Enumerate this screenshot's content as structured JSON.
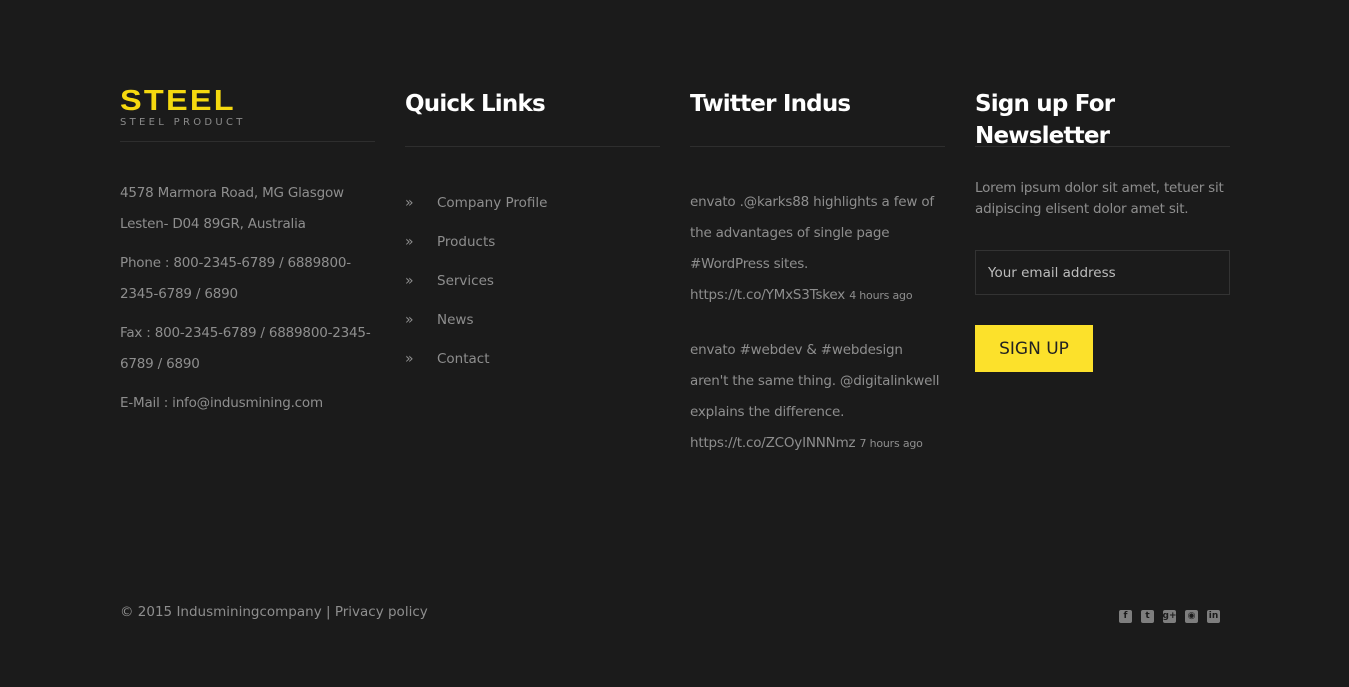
{
  "logo": {
    "main": "STEEL",
    "sub": "STEEL PRODUCT"
  },
  "contact": {
    "address_line1": "4578 Marmora Road, MG Glasgow",
    "address_line2": "Lesten- D04 89GR, Australia",
    "phone": "Phone : 800-2345-6789 / 6889800-2345-6789 / 6890",
    "fax": "Fax : 800-2345-6789 / 6889800-2345-6789 / 6890",
    "email": "E-Mail : info@indusmining.com"
  },
  "quick_links": {
    "title": "Quick Links",
    "arrow": "»",
    "items": [
      "Company Profile",
      "Products",
      "Services",
      "News",
      "Contact"
    ]
  },
  "twitter": {
    "title": "Twitter Indus",
    "tweets": [
      {
        "text": "envato .@karks88 highlights a few of the advantages of single page #WordPress sites.",
        "link": "https://t.co/YMxS3Tskex",
        "time": "4 hours ago"
      },
      {
        "text": "envato #webdev & #webdesign aren't the same thing. @digitalinkwell explains the difference.",
        "link": "https://t.co/ZCOyINNNmz",
        "time": "7 hours ago"
      }
    ]
  },
  "newsletter": {
    "title": "Sign up For Newsletter",
    "text": "Lorem ipsum dolor sit amet, tetuer sit adipiscing elisent dolor amet sit.",
    "placeholder": "Your email address",
    "button": "SIGN UP"
  },
  "bottom": {
    "copyright": "© 2015 Indusminingcompany | Privacy policy",
    "socials": [
      {
        "icon": "facebook-icon",
        "glyph": "f"
      },
      {
        "icon": "twitter-icon",
        "glyph": "t"
      },
      {
        "icon": "google-plus-icon",
        "glyph": "g+"
      },
      {
        "icon": "rss-icon",
        "glyph": "◉"
      },
      {
        "icon": "linkedin-icon",
        "glyph": "in"
      }
    ]
  },
  "colors": {
    "background": "#1b1b1b",
    "accent": "#fce12b",
    "text": "#8e8e8e",
    "title": "#ffffff"
  }
}
